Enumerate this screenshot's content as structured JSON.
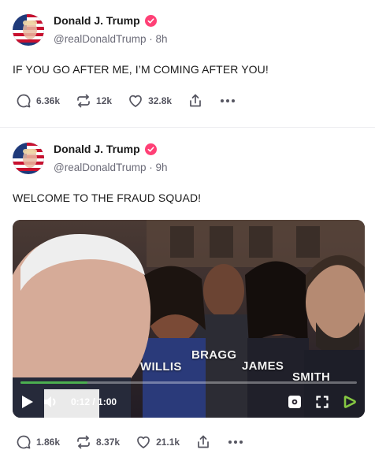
{
  "posts": [
    {
      "author": {
        "name": "Donald J. Trump",
        "handle": "@realDonaldTrump",
        "separator": "·",
        "time": "8h"
      },
      "text": "IF YOU GO AFTER ME, I’M COMING AFTER YOU!",
      "stats": {
        "replies": "6.36k",
        "reposts": "12k",
        "likes": "32.8k"
      }
    },
    {
      "author": {
        "name": "Donald J. Trump",
        "handle": "@realDonaldTrump",
        "separator": "·",
        "time": "9h"
      },
      "text": "WELCOME TO THE FRAUD SQUAD!",
      "video": {
        "captions": [
          "WILLIS",
          "BRAGG",
          "JAMES",
          "SMITH"
        ],
        "current_time": "0:12",
        "time_separator": " / ",
        "duration": "1:00",
        "progress": 0.2
      },
      "stats": {
        "replies": "1.86k",
        "reposts": "8.37k",
        "likes": "21.1k"
      }
    }
  ],
  "icons": {
    "reply": "speech-bubble-icon",
    "repost": "repost-arrows-icon",
    "like": "heart-icon",
    "share": "share-upload-icon",
    "more": "more-dots-icon",
    "verified": "verified-badge-icon",
    "play": "play-icon",
    "volume": "volume-icon",
    "settings": "settings-gear-icon",
    "fullscreen": "fullscreen-icon",
    "brand": "rumble-play-icon"
  },
  "colors": {
    "verified": "#ff4076",
    "progress": "#4caf50",
    "text_muted": "#6b6b78"
  }
}
